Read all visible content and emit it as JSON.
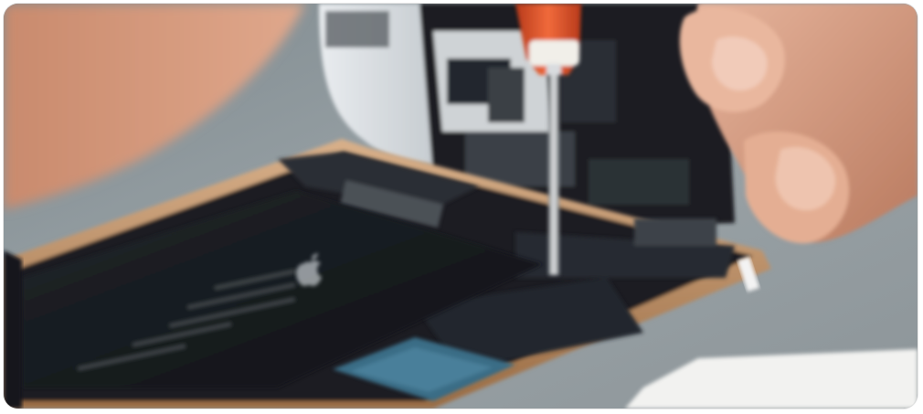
{
  "image": {
    "subject": "phone-repair-photo",
    "colors": {
      "background_table": "#9aa0a3",
      "phone_frame_gold": "#b88a5c",
      "battery_black": "#15191d",
      "board_dark": "#1c2025",
      "screwdriver_handle": "#e2542a",
      "screwdriver_shaft": "#b8bcbf",
      "skin": "#d79a7e",
      "display_panel_gray": "#cfd3d6"
    },
    "icons": [
      "apple-logo-icon"
    ]
  }
}
